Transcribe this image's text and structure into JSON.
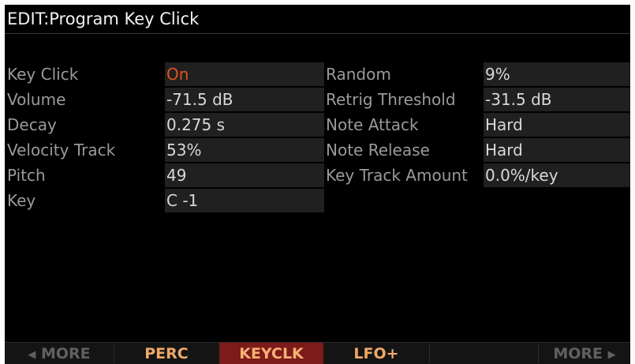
{
  "title": "EDIT:Program Key Click",
  "params_left": [
    {
      "label": "Key Click",
      "value": "On"
    },
    {
      "label": "Volume",
      "value": "-71.5 dB"
    },
    {
      "label": "Decay",
      "value": "0.275 s"
    },
    {
      "label": "Velocity Track",
      "value": "53%"
    },
    {
      "label": "Pitch",
      "value": "49"
    },
    {
      "label": "Key",
      "value": "C -1"
    }
  ],
  "params_right": [
    {
      "label": "Random",
      "value": "9%"
    },
    {
      "label": "Retrig Threshold",
      "value": "-31.5 dB"
    },
    {
      "label": "Note Attack",
      "value": "Hard"
    },
    {
      "label": "Note Release",
      "value": "Hard"
    },
    {
      "label": "Key Track Amount",
      "value": "0.0%/key"
    }
  ],
  "softbar": {
    "more_left": "MORE",
    "perc": "PERC",
    "keyclk": "KEYCLK",
    "lfo": "LFO+",
    "more_right": "MORE",
    "left_arrow_icon": "triangle-left",
    "right_arrow_icon": "triangle-right"
  },
  "colors": {
    "background": "#000000",
    "value_bg": "#202020",
    "on_value": "#e0521f",
    "softkey_text": "#f0a868",
    "softkey_active_bg": "#7d1a1a"
  }
}
